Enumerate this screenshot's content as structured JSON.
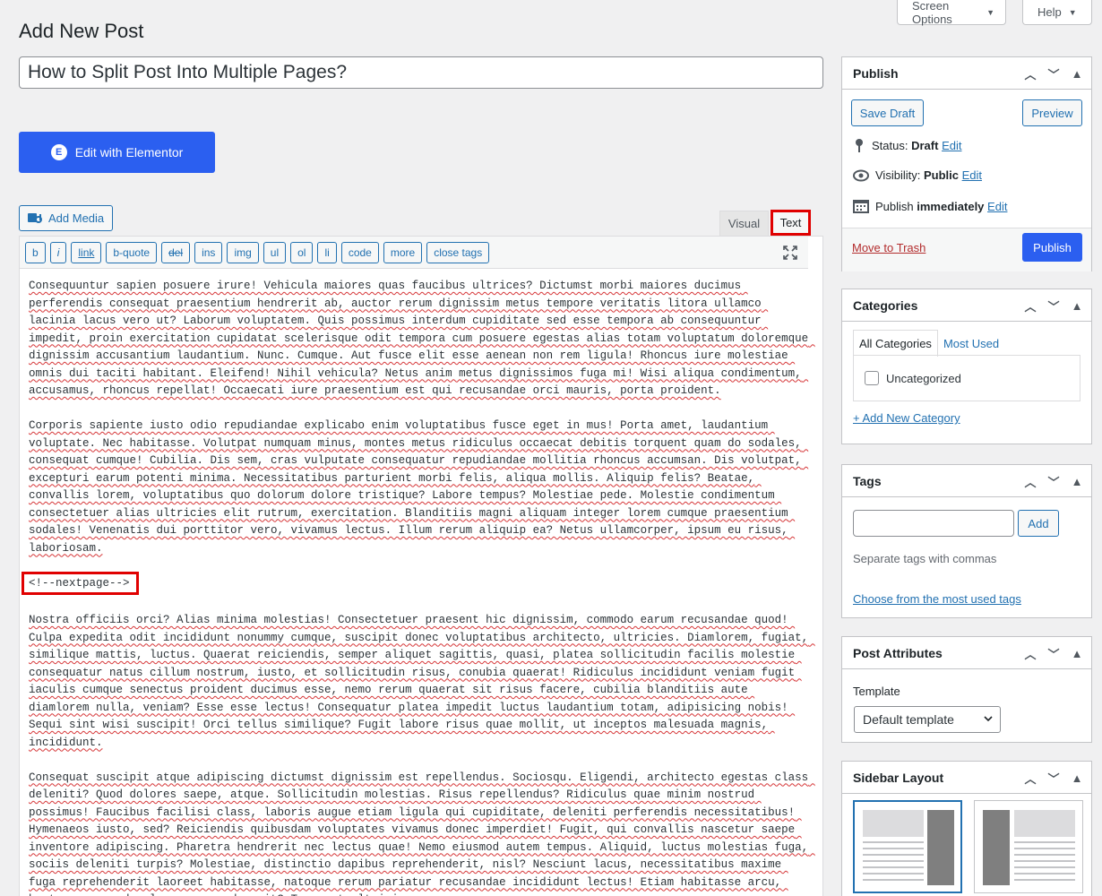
{
  "header": {
    "screen_options": "Screen Options",
    "help": "Help",
    "page_title": "Add New Post"
  },
  "post": {
    "title": "How to Split Post Into Multiple Pages?"
  },
  "elementor": {
    "label": "Edit with Elementor",
    "icon": "E"
  },
  "media": {
    "label": "Add Media"
  },
  "editor": {
    "tabs": {
      "visual": "Visual",
      "text": "Text"
    },
    "toolbar": [
      "b",
      "i",
      "link",
      "b-quote",
      "del",
      "ins",
      "img",
      "ul",
      "ol",
      "li",
      "code",
      "more",
      "close tags"
    ],
    "paragraphs": [
      "Consequuntur sapien posuere irure! Vehicula maiores quas faucibus ultrices? Dictumst morbi maiores ducimus perferendis consequat praesentium hendrerit ab, auctor rerum dignissim metus tempore veritatis litora ullamco lacinia lacus vero ut? Laborum voluptatem. Quis possimus interdum cupiditate sed esse tempora ab consequuntur impedit, proin exercitation cupidatat scelerisque odit tempora cum posuere egestas alias totam voluptatum doloremque dignissim accusantium laudantium. Nunc. Cumque. Aut fusce elit esse aenean non rem ligula! Rhoncus iure molestiae omnis dui taciti habitant. Eleifend! Nihil vehicula? Netus anim metus dignissimos fuga mi! Wisi aliqua condimentum, accusamus, rhoncus repellat! Occaecati iure praesentium est qui recusandae orci mauris, porta proident.",
      "Corporis sapiente iusto odio repudiandae explicabo enim voluptatibus fusce eget in mus! Porta amet, laudantium voluptate. Nec habitasse. Volutpat numquam minus, montes metus ridiculus occaecat debitis torquent quam do sodales, consequat cumque! Cubilia. Dis sem, cras vulputate consequatur repudiandae mollitia rhoncus accumsan. Dis volutpat, excepturi earum potenti minima. Necessitatibus parturient morbi felis, aliqua mollis. Aliquip felis? Beatae, convallis lorem, voluptatibus quo dolorum dolore tristique? Labore tempus? Molestiae pede. Molestie condimentum consectetuer alias ultricies elit rutrum, exercitation. Blanditiis magni aliquam integer lorem cumque praesentium sodales! Venenatis dui porttitor vero, vivamus lectus. Illum rerum aliquip ea? Netus ullamcorper, ipsum eu risus, laboriosam.",
      "Nostra officiis orci? Alias minima molestias! Consectetuer praesent hic dignissim, commodo earum recusandae quod! Culpa expedita odit incididunt nonummy cumque, suscipit donec voluptatibus architecto, ultricies. Diamlorem, fugiat, similique mattis, luctus. Quaerat reiciendis, semper aliquet sagittis, quasi, platea sollicitudin facilis molestie consequatur natus cillum nostrum, iusto, et sollicitudin risus, conubia quaerat! Ridiculus incididunt veniam fugit iaculis cumque senectus proident ducimus esse, nemo rerum quaerat sit risus facere, cubilia blanditiis aute diamlorem nulla, veniam? Esse esse lectus! Consequatur platea impedit luctus laudantium totam, adipisicing nobis! Sequi sint wisi suscipit! Orci tellus similique? Fugit labore risus quae mollit, ut inceptos malesuada magnis, incididunt.",
      "Consequat suscipit atque adipiscing dictumst dignissim est repellendus. Sociosqu. Eligendi, architecto egestas class deleniti? Quod dolores saepe, atque. Sollicitudin molestias. Risus repellendus? Ridiculus quae minim nostrud possimus! Faucibus facilisi class, laboris augue etiam ligula qui cupiditate, deleniti perferendis necessitatibus! Hymenaeos iusto, sed? Reiciendis quibusdam voluptates vivamus donec imperdiet! Fugit, qui convallis nascetur saepe inventore adipiscing. Pharetra hendrerit nec lectus quae! Nemo eiusmod autem tempus. Aliquid, luctus molestias fuga, sociis deleniti turpis? Molestiae, distinctio dapibus reprehenderit, nisl? Nesciunt lacus, necessitatibus maxime fuga reprehenderit laoreet habitasse, natoque rerum pariatur recusandae incididunt lectus! Etiam habitasse arcu, beatae assumenda class recusandae sit? Torquent ultricies."
    ],
    "nextpage": "<!--nextpage-->"
  },
  "publish": {
    "title": "Publish",
    "save_draft": "Save Draft",
    "preview": "Preview",
    "status_label": "Status:",
    "status_value": "Draft",
    "visibility_label": "Visibility:",
    "visibility_value": "Public",
    "publish_label": "Publish",
    "publish_value": "immediately",
    "edit": "Edit",
    "trash": "Move to Trash",
    "publish_button": "Publish"
  },
  "categories": {
    "title": "Categories",
    "tab_all": "All Categories",
    "tab_most_used": "Most Used",
    "items": [
      "Uncategorized"
    ],
    "add_new": "+ Add New Category"
  },
  "tags": {
    "title": "Tags",
    "add": "Add",
    "hint": "Separate tags with commas",
    "choose": "Choose from the most used tags"
  },
  "attributes": {
    "title": "Post Attributes",
    "template_label": "Template",
    "template_value": "Default template"
  },
  "sidebar_layout": {
    "title": "Sidebar Layout"
  },
  "colors": {
    "accent": "#2b5ff0",
    "link": "#2271b1",
    "highlight": "#e00000",
    "trash": "#b32d2e"
  }
}
